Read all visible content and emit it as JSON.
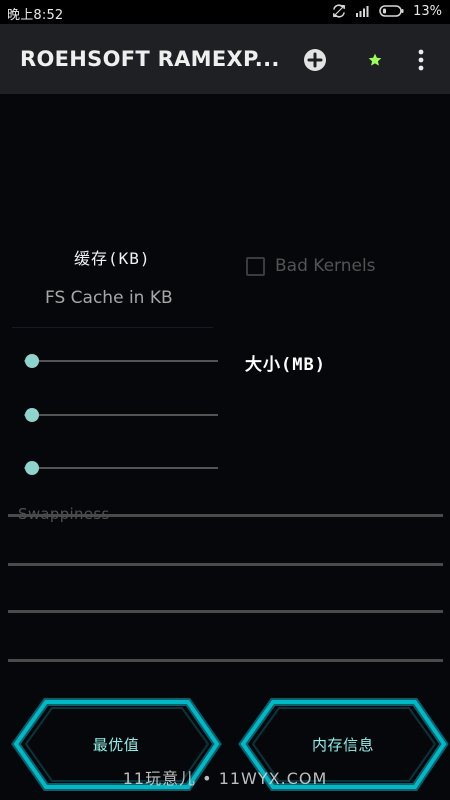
{
  "status_bar": {
    "time": "晚上8:52",
    "battery_percent": "13%",
    "icons": [
      "sync-icon",
      "signal-icon",
      "battery-icon"
    ]
  },
  "app_bar": {
    "title": "ROEHSOFT RAMEXP...",
    "actions": [
      "add-circle-icon",
      "star-icon",
      "more-vert-icon"
    ],
    "colors": {
      "background": "#1f2023",
      "star": "#9dff5e"
    }
  },
  "content": {
    "cache_title": "缓存(KB)",
    "cache_subtitle": "FS Cache in KB",
    "bad_kernels_label": "Bad Kernels",
    "bad_kernels_checked": false,
    "size_label": "大小(MB)",
    "sliders": [
      {
        "value": 0
      },
      {
        "value": 0
      },
      {
        "value": 0
      }
    ],
    "swappiness_label": "Swappiness"
  },
  "buttons": {
    "optimal_label": "最优值",
    "memory_info_label": "内存信息"
  },
  "watermark": "11玩意儿 • 11WYX.COM",
  "colors": {
    "accent": "#8fd4cc",
    "button_stroke": "#00b8c6",
    "button_text": "#8ef0ea"
  }
}
